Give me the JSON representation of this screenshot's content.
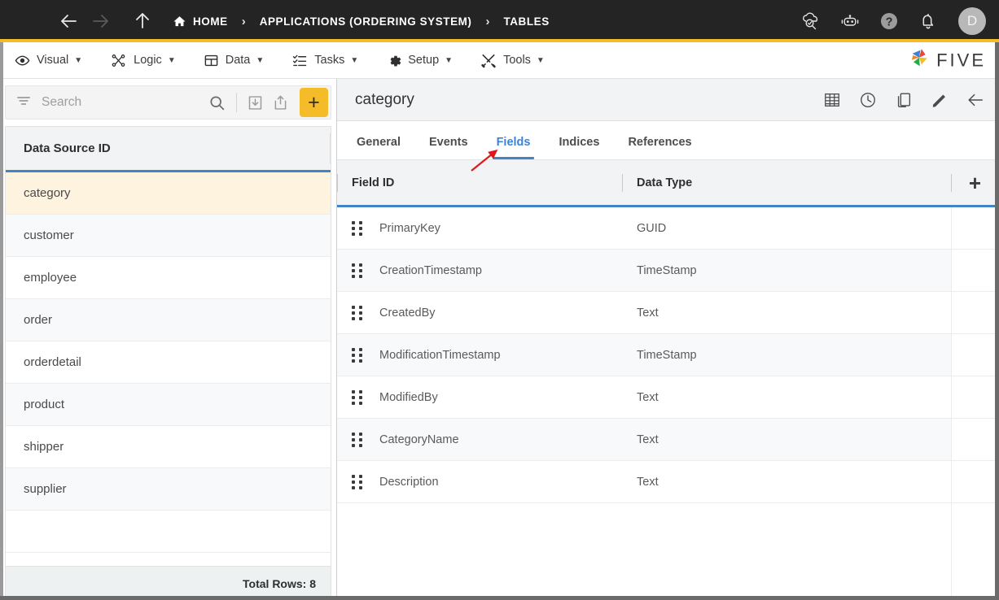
{
  "topbar": {
    "menu_icon": "hamburger-icon",
    "back_label": "back-arrow-icon",
    "forward_label": "forward-arrow-icon",
    "up_label": "up-arrow-icon",
    "breadcrumbs": [
      {
        "label": "HOME",
        "icon": "home-icon"
      },
      {
        "label": "APPLICATIONS (ORDERING SYSTEM)",
        "icon": ""
      },
      {
        "label": "TABLES",
        "icon": ""
      }
    ],
    "separator": "›",
    "right_icons": [
      {
        "name": "cloud-search-icon"
      },
      {
        "name": "chatbot-icon"
      },
      {
        "name": "help-icon"
      },
      {
        "name": "notifications-bell-icon"
      }
    ],
    "avatar_initial": "D"
  },
  "menubar": {
    "items": [
      {
        "label": "Visual",
        "icon": "eye-icon",
        "caret": "▼"
      },
      {
        "label": "Logic",
        "icon": "flow-nodes-icon",
        "caret": "▼"
      },
      {
        "label": "Data",
        "icon": "grid-icon",
        "caret": "▼"
      },
      {
        "label": "Tasks",
        "icon": "checklist-icon",
        "caret": "▼"
      },
      {
        "label": "Setup",
        "icon": "gear-icon",
        "caret": "▼"
      },
      {
        "label": "Tools",
        "icon": "tools-icon",
        "caret": "▼"
      }
    ],
    "brand": "FIVE"
  },
  "sidebar": {
    "search": {
      "placeholder": "Search",
      "value": ""
    },
    "toolbar": {
      "filter_icon": "filter-icon",
      "search_icon": "search-icon",
      "import_icon": "import-icon",
      "export_icon": "export-icon",
      "add_label": "+"
    },
    "table": {
      "header": "Data Source ID",
      "rows": [
        {
          "name": "category",
          "selected": true
        },
        {
          "name": "customer",
          "selected": false
        },
        {
          "name": "employee",
          "selected": false
        },
        {
          "name": "order",
          "selected": false
        },
        {
          "name": "orderdetail",
          "selected": false
        },
        {
          "name": "product",
          "selected": false
        },
        {
          "name": "shipper",
          "selected": false
        },
        {
          "name": "supplier",
          "selected": false
        }
      ],
      "footer": "Total Rows: 8"
    }
  },
  "main": {
    "title": "category",
    "toolbar_icons": [
      {
        "name": "table-view-icon"
      },
      {
        "name": "history-clock-icon"
      },
      {
        "name": "duplicate-icon"
      },
      {
        "name": "edit-pencil-icon"
      },
      {
        "name": "back-arrow-icon"
      }
    ],
    "tabs": [
      {
        "label": "General",
        "active": false
      },
      {
        "label": "Events",
        "active": false
      },
      {
        "label": "Fields",
        "active": true
      },
      {
        "label": "Indices",
        "active": false
      },
      {
        "label": "References",
        "active": false
      }
    ],
    "fields_table": {
      "columns": [
        "Field ID",
        "Data Type"
      ],
      "add_label": "+",
      "rows": [
        {
          "field_id": "PrimaryKey",
          "data_type": "GUID"
        },
        {
          "field_id": "CreationTimestamp",
          "data_type": "TimeStamp"
        },
        {
          "field_id": "CreatedBy",
          "data_type": "Text"
        },
        {
          "field_id": "ModificationTimestamp",
          "data_type": "TimeStamp"
        },
        {
          "field_id": "ModifiedBy",
          "data_type": "Text"
        },
        {
          "field_id": "CategoryName",
          "data_type": "Text"
        },
        {
          "field_id": "Description",
          "data_type": "Text"
        }
      ]
    }
  },
  "annotation": {
    "type": "red-arrow",
    "points_to": "Fields"
  },
  "colors": {
    "accent_yellow": "#f5bc2a",
    "accent_blue": "#4285c5",
    "tab_active": "#3b82d8",
    "selected_row": "#fdf3de",
    "topbar_bg": "#242424",
    "annotation_red": "#e11717"
  }
}
